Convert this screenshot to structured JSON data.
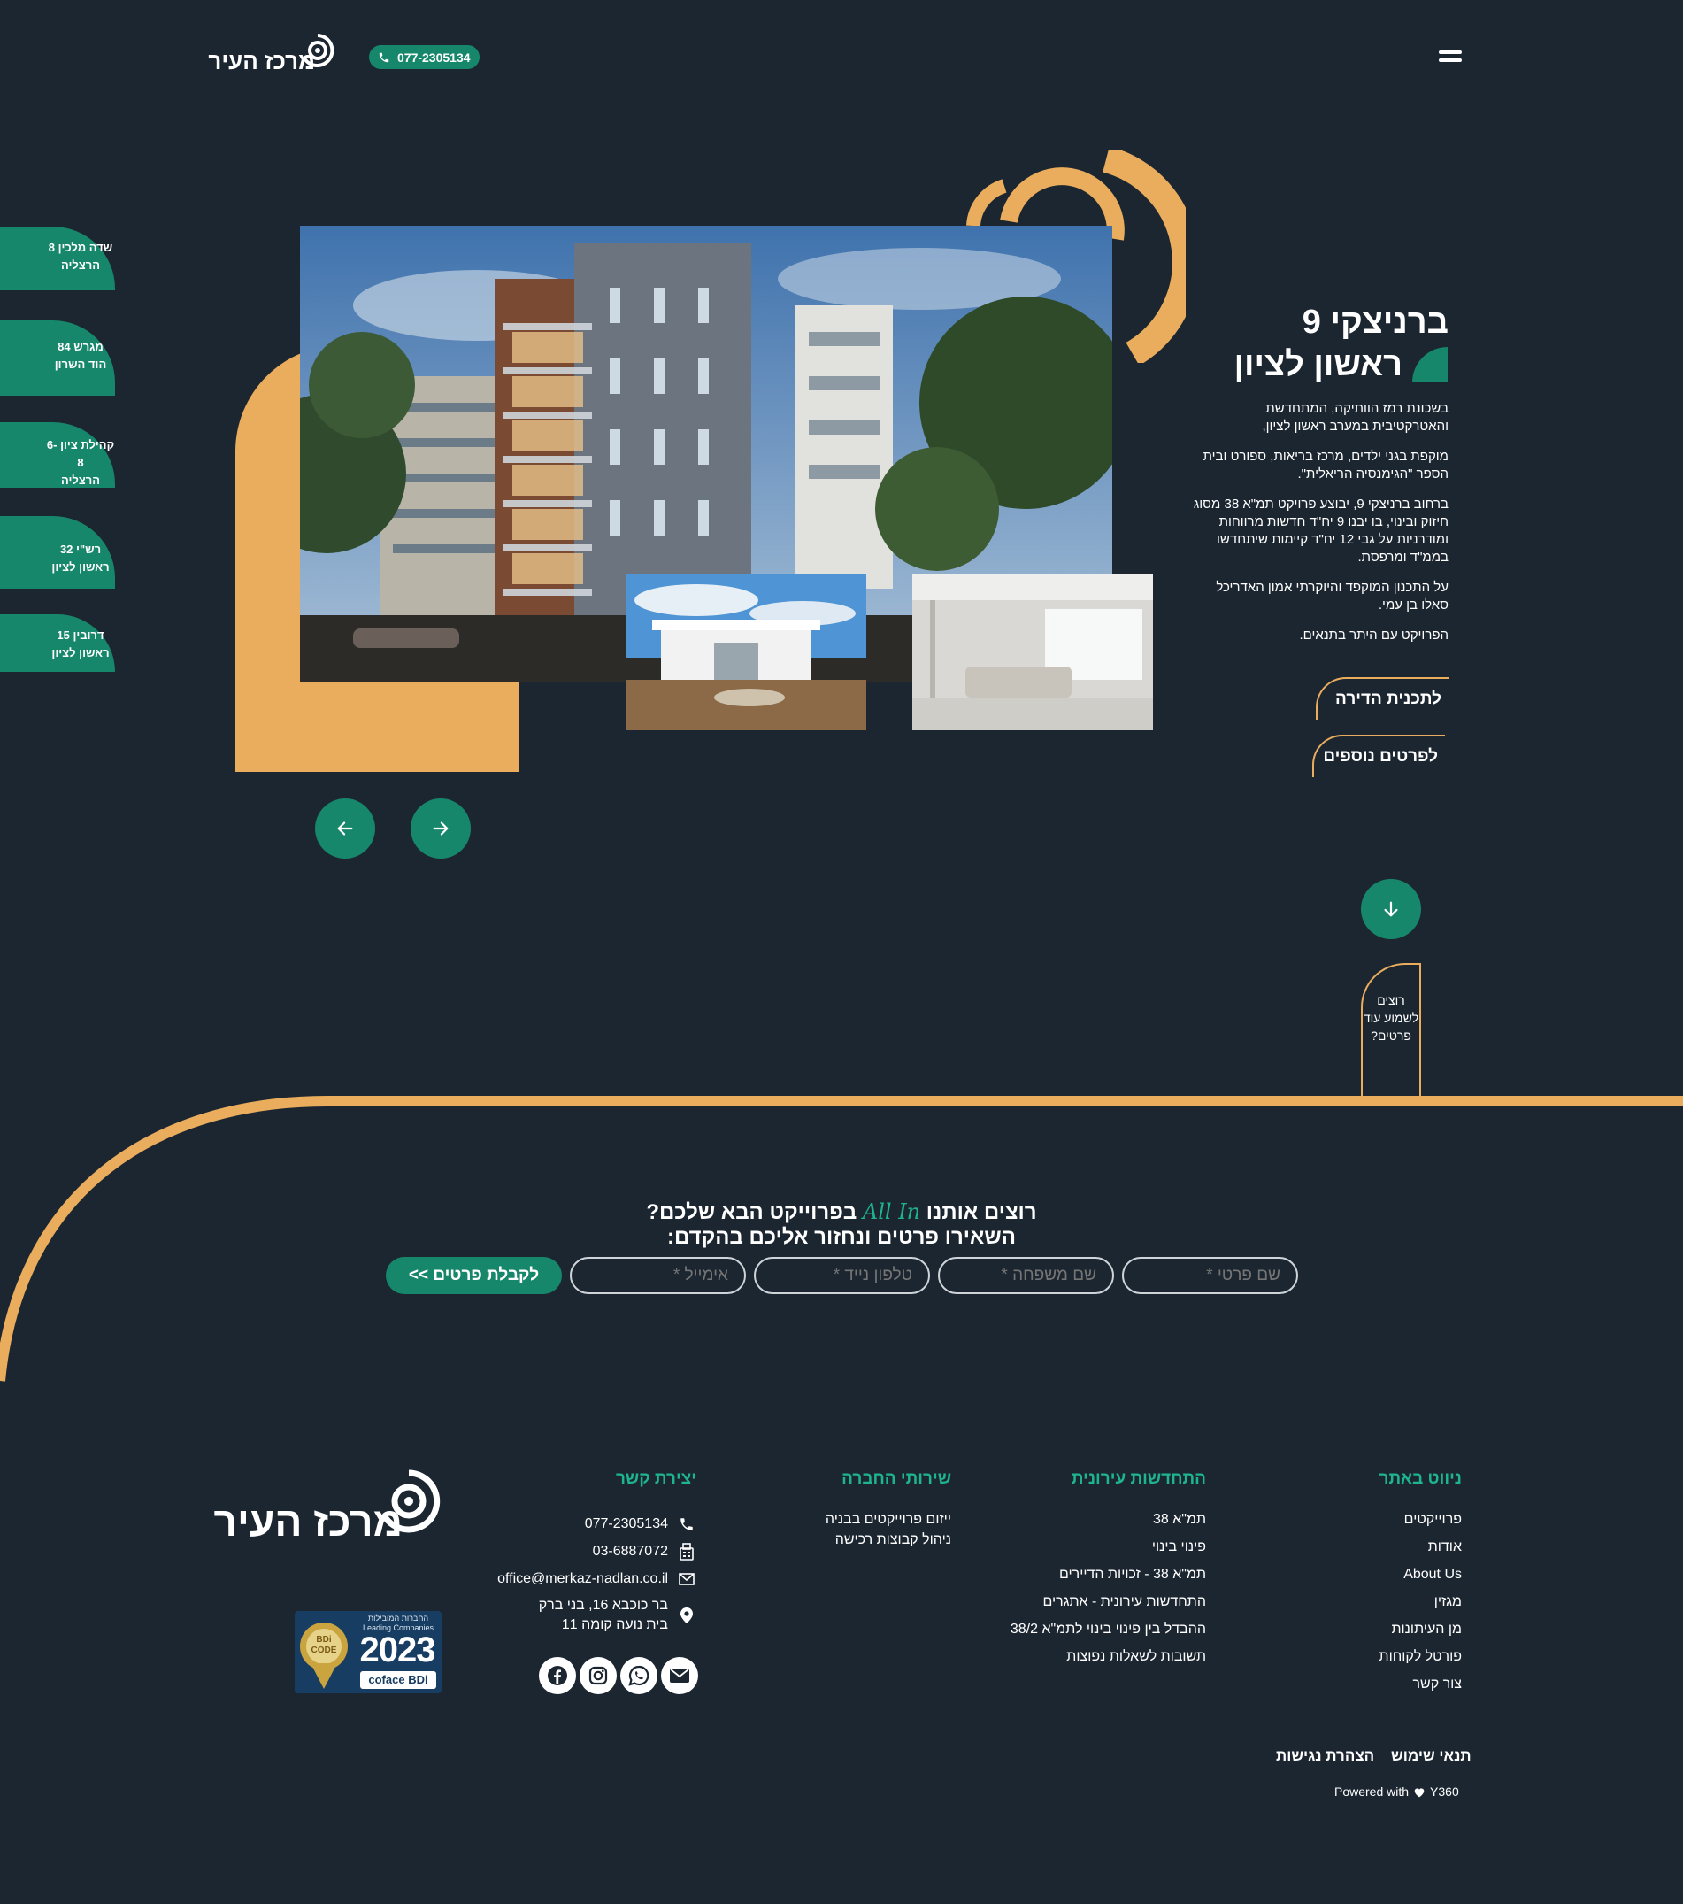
{
  "header": {
    "logo_text": "מרכז העיר",
    "phone": "077-2305134"
  },
  "side_projects": [
    {
      "line1": "שדה מלכין 8",
      "line2": "הרצליה"
    },
    {
      "line1": "מגרש 84",
      "line2": "הוד השרון"
    },
    {
      "line1": "קהילת ציון 6-8",
      "line2": "הרצליה"
    },
    {
      "line1": "רש\"י 32",
      "line2": "ראשון לציון"
    },
    {
      "line1": "דרובין 15",
      "line2": "ראשון לציון"
    }
  ],
  "hero": {
    "title_line1": "ברניצקי 9",
    "title_line2": "ראשון לציון",
    "paragraphs": [
      "בשכונת רמז הוותיקה, המתחדשת והאטרקטיבית במערב ראשון לציון,",
      "מוקפת בגני ילדים, מרכז בריאות, ספורט ובית הספר \"הגימנסיה הריאלית\".",
      "ברחוב ברניצקי 9, יבוצע פרויקט תמ\"א 38 מסוג חיזוק ובינוי, בו יבנו 9 יח\"ד חדשות מרווחות ומודרניות על גבי 12 יח\"ד קיימות שיתחדשו בממ\"ד ומרפסת.",
      "על התכנון המוקפד והיוקרתי אמון האדריכל סאלו בן עמי.",
      "הפרויקט עם היתר בתנאים."
    ],
    "cta_plans": "לתכנית הדירה",
    "cta_details": "לפרטים נוספים",
    "more_info": "רוצים לשמוע עוד פרטים?"
  },
  "lead_form": {
    "title_start": "רוצים אותנו",
    "title_script": "All In",
    "title_end": "בפרוייקט הבא שלכם?",
    "subtitle": "השאירו פרטים ונחזור אליכם בהקדם:",
    "first_name_placeholder": "שם פרטי *",
    "last_name_placeholder": "שם משפחה *",
    "mobile_placeholder": "טלפון נייד *",
    "email_placeholder": "אימייל *",
    "submit_label": "לקבלת פרטים >>"
  },
  "footer": {
    "nav_title": "ניווט באתר",
    "nav_items": [
      "פרוייקטים",
      "אודות",
      "About Us",
      "מגזין",
      "מן העיתונות",
      "פורטל לקוחות",
      "צור קשר"
    ],
    "renewal_title": "התחדשות עירונית",
    "renewal_items": [
      "תמ\"א 38",
      "פינוי בינוי",
      "תמ\"א 38 - זכויות הדיירים",
      "התחדשות עירונית - אתגרים",
      "ההבדל בין פינוי בינוי לתמ\"א 38/2",
      "תשובות לשאלות נפוצות"
    ],
    "services_title": "שירותי החברה",
    "services_items": [
      "ייזום פרוייקטים בבניה",
      "ניהול קבוצות רכישה"
    ],
    "contact_title": "יצירת קשר",
    "phone": "077-2305134",
    "fax": "03-6887072",
    "email": "office@merkaz-nadlan.co.il",
    "address_line1": "בר כוכבא 16, בני ברק",
    "address_line2": "בית נועה קומה 11",
    "logo_text": "מרכז העיר",
    "badge_top": "החברות המובילות",
    "badge_sub": "Leading Companies",
    "badge_year": "2023",
    "badge_bdi": "BDi CODE",
    "badge_brand": "coface BDi",
    "terms": "תנאי שימוש",
    "accessibility": "הצהרת נגישות",
    "powered_prefix": "Powered with",
    "powered_brand": "Y360"
  },
  "colors": {
    "background": "#1c2630",
    "green": "#17876b",
    "green_text": "#1db48f",
    "gold": "#e9ad5d"
  }
}
